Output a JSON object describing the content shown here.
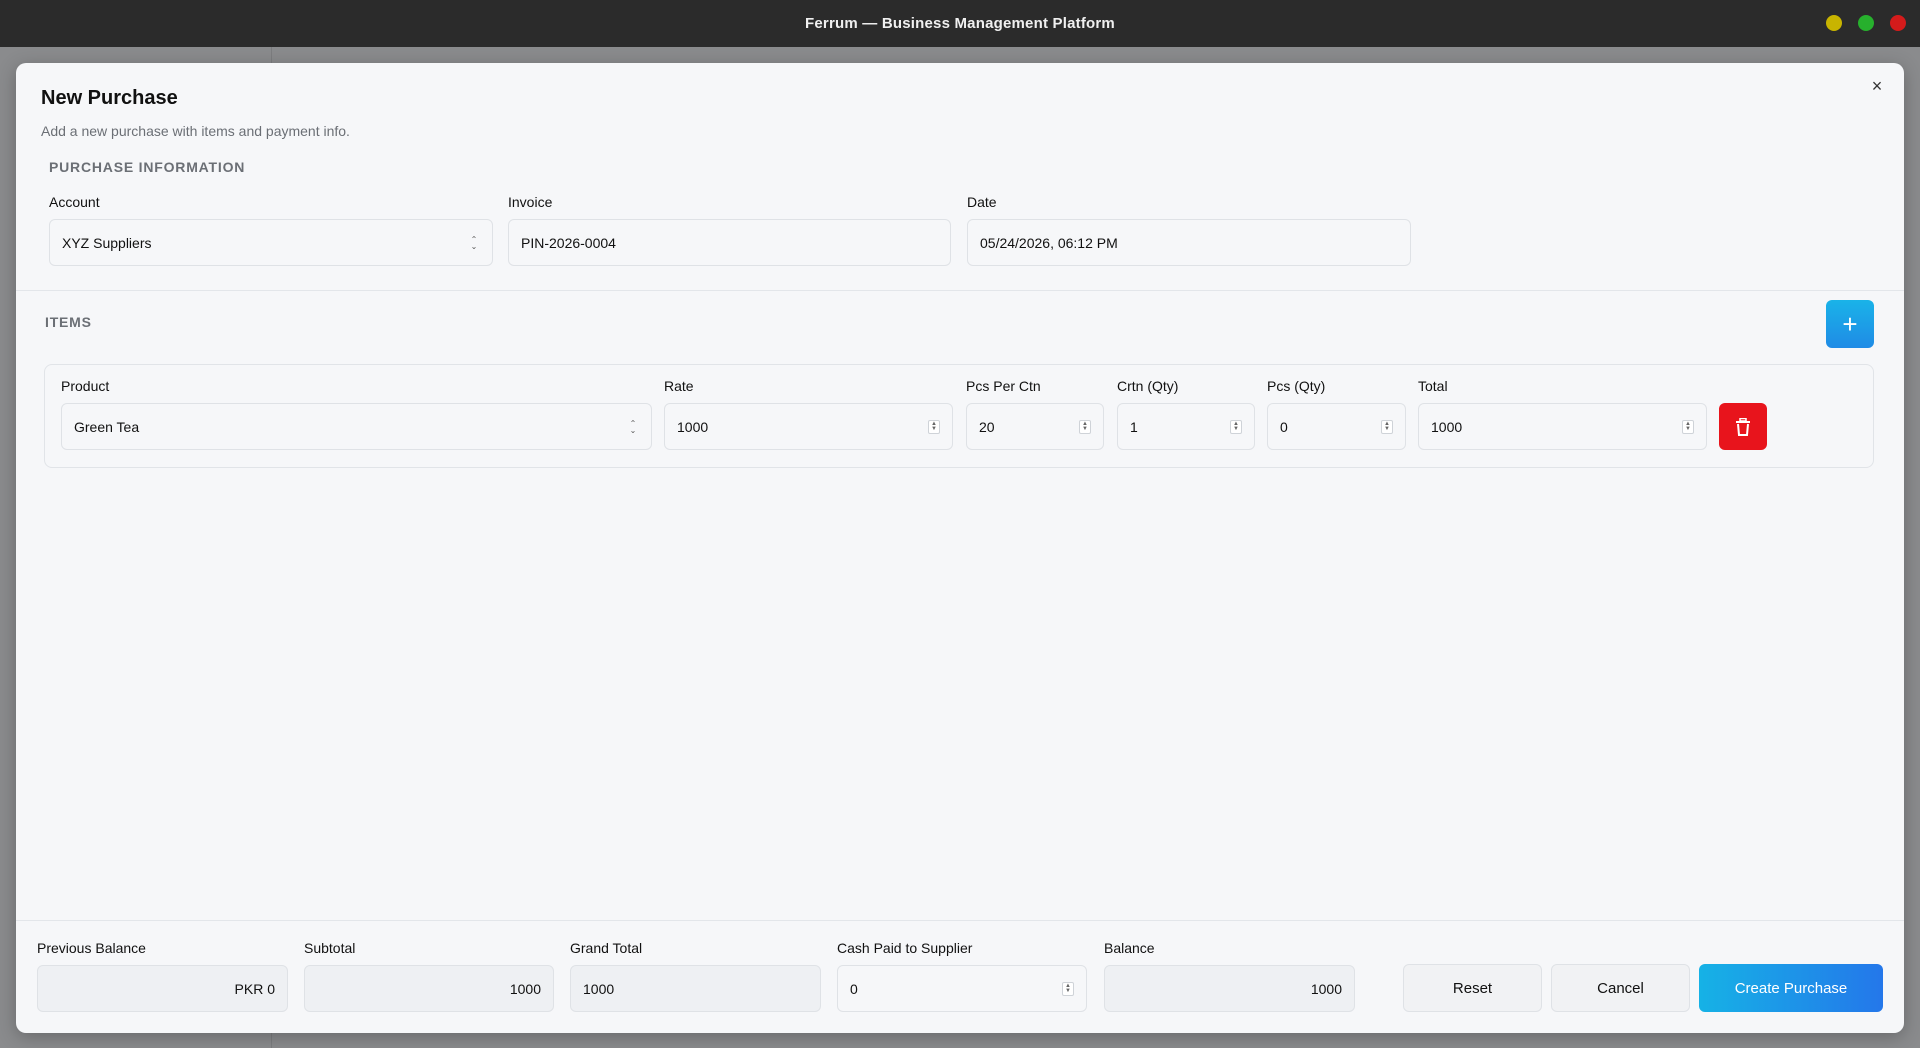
{
  "window": {
    "title": "Ferrum — Business Management Platform"
  },
  "modal": {
    "title": "New Purchase",
    "subtitle": "Add a new purchase with items and payment info.",
    "close_icon": "×"
  },
  "purchase_info": {
    "section_label": "PURCHASE INFORMATION",
    "account": {
      "label": "Account",
      "value": "XYZ Suppliers"
    },
    "invoice": {
      "label": "Invoice",
      "value": "PIN-2026-0004"
    },
    "date": {
      "label": "Date",
      "value": "05/24/2026, 06:12 PM"
    }
  },
  "items": {
    "section_label": "ITEMS",
    "add_icon": "+",
    "columns": {
      "product": "Product",
      "rate": "Rate",
      "pcs_per_ctn": "Pcs Per Ctn",
      "crtn_qty": "Crtn (Qty)",
      "pcs_qty": "Pcs (Qty)",
      "total": "Total"
    },
    "rows": [
      {
        "product": "Green Tea",
        "rate": "1000",
        "pcs_per_ctn": "20",
        "crtn_qty": "1",
        "pcs_qty": "0",
        "total": "1000"
      }
    ]
  },
  "footer": {
    "previous_balance": {
      "label": "Previous Balance",
      "value": "PKR 0"
    },
    "subtotal": {
      "label": "Subtotal",
      "value": "1000"
    },
    "grand_total": {
      "label": "Grand Total",
      "value": "1000"
    },
    "cash_paid": {
      "label": "Cash Paid to Supplier",
      "value": "0"
    },
    "balance": {
      "label": "Balance",
      "value": "1000"
    },
    "reset_label": "Reset",
    "cancel_label": "Cancel",
    "create_label": "Create Purchase"
  },
  "colors": {
    "primary": "#1f8be6",
    "danger": "#e8141c"
  }
}
